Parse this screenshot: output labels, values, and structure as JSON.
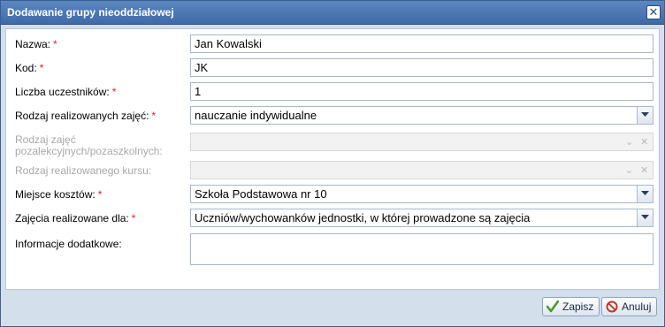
{
  "dialog": {
    "title": "Dodawanie grupy nieoddziałowej",
    "close_glyph": "✕"
  },
  "form": {
    "nazwa": {
      "label": "Nazwa:",
      "value": "Jan Kowalski",
      "required": "*"
    },
    "kod": {
      "label": "Kod:",
      "value": "JK",
      "required": "*"
    },
    "liczba": {
      "label": "Liczba uczestników:",
      "value": "1",
      "required": "*"
    },
    "rodzaj_zajec": {
      "label": "Rodzaj realizowanych zajęć:",
      "value": "nauczanie indywidualne",
      "required": "*"
    },
    "rodzaj_pozalekcyjnych": {
      "label_line1": "Rodzaj zajęć",
      "label_line2": "pozalekcyjnych/pozaszkolnych:",
      "value": ""
    },
    "rodzaj_kursu": {
      "label": "Rodzaj realizowanego kursu:",
      "value": ""
    },
    "miejsce_kosztow": {
      "label": "Miejsce kosztów:",
      "value": "Szkoła Podstawowa nr 10",
      "required": "*"
    },
    "zajecia_dla": {
      "label": "Zajęcia realizowane dla:",
      "value": "Uczniów/wychowanków jednostki, w której prowadzone są  zajęcia",
      "required": "*"
    },
    "informacje": {
      "label": "Informacje dodatkowe:",
      "value": ""
    }
  },
  "footer": {
    "save_label": "Zapisz",
    "cancel_label": "Anuluj"
  },
  "icons": {
    "save": "checkmark-icon",
    "cancel": "cancel-icon",
    "dropdown": "chevron-down-icon",
    "clear": "clear-icon"
  },
  "colors": {
    "titlebar": "#4a76b3",
    "required": "#e02020",
    "save_check": "#4a9a2a",
    "cancel_red": "#c0392b"
  }
}
